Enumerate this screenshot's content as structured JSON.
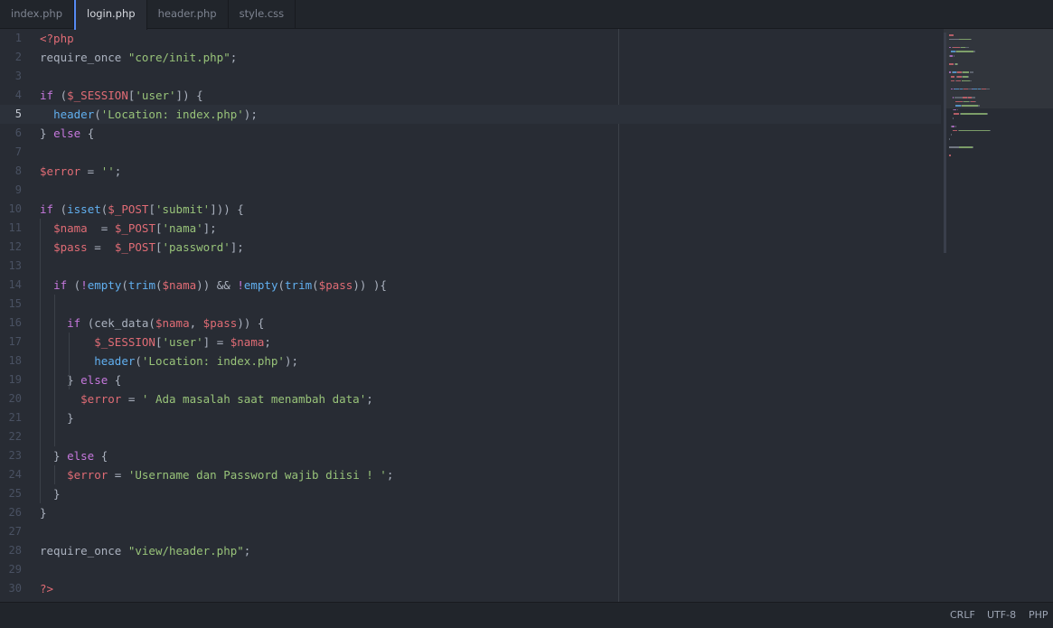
{
  "tabs": [
    {
      "label": "index.php",
      "active": false
    },
    {
      "label": "login.php",
      "active": true
    },
    {
      "label": "header.php",
      "active": false
    },
    {
      "label": "style.css",
      "active": false
    }
  ],
  "editor": {
    "current_line": 5,
    "lines": [
      {
        "n": "1",
        "tokens": [
          [
            "tag",
            "<?php"
          ]
        ]
      },
      {
        "n": "2",
        "tokens": [
          [
            "fnp",
            "require_once "
          ],
          [
            "str",
            "\"core/init.php\""
          ],
          [
            "pun",
            ";"
          ]
        ]
      },
      {
        "n": "3",
        "tokens": []
      },
      {
        "n": "4",
        "tokens": [
          [
            "kw",
            "if"
          ],
          [
            "pun",
            " ("
          ],
          [
            "var",
            "$_SESSION"
          ],
          [
            "pun",
            "["
          ],
          [
            "str",
            "'user'"
          ],
          [
            "pun",
            "]) {"
          ]
        ]
      },
      {
        "n": "5",
        "tokens": [
          [
            "pun",
            "  "
          ],
          [
            "fn",
            "header"
          ],
          [
            "pun",
            "("
          ],
          [
            "str",
            "'Location: index.php'"
          ],
          [
            "pun",
            ");"
          ]
        ]
      },
      {
        "n": "6",
        "tokens": [
          [
            "pun",
            "} "
          ],
          [
            "kw",
            "else"
          ],
          [
            "pun",
            " {"
          ]
        ]
      },
      {
        "n": "7",
        "tokens": []
      },
      {
        "n": "8",
        "tokens": [
          [
            "var",
            "$error"
          ],
          [
            "pun",
            " = "
          ],
          [
            "str",
            "''"
          ],
          [
            "pun",
            ";"
          ]
        ]
      },
      {
        "n": "9",
        "tokens": []
      },
      {
        "n": "10",
        "tokens": [
          [
            "kw",
            "if"
          ],
          [
            "pun",
            " ("
          ],
          [
            "fn",
            "isset"
          ],
          [
            "pun",
            "("
          ],
          [
            "var",
            "$_POST"
          ],
          [
            "pun",
            "["
          ],
          [
            "str",
            "'submit'"
          ],
          [
            "pun",
            "])) {"
          ]
        ]
      },
      {
        "n": "11",
        "tokens": [
          [
            "pun",
            "  "
          ],
          [
            "var",
            "$nama"
          ],
          [
            "pun",
            "  = "
          ],
          [
            "var",
            "$_POST"
          ],
          [
            "pun",
            "["
          ],
          [
            "str",
            "'nama'"
          ],
          [
            "pun",
            "];"
          ]
        ]
      },
      {
        "n": "12",
        "tokens": [
          [
            "pun",
            "  "
          ],
          [
            "var",
            "$pass"
          ],
          [
            "pun",
            " =  "
          ],
          [
            "var",
            "$_POST"
          ],
          [
            "pun",
            "["
          ],
          [
            "str",
            "'password'"
          ],
          [
            "pun",
            "];"
          ]
        ]
      },
      {
        "n": "13",
        "tokens": []
      },
      {
        "n": "14",
        "tokens": [
          [
            "pun",
            "  "
          ],
          [
            "kw",
            "if"
          ],
          [
            "pun",
            " ("
          ],
          [
            "kw",
            "!"
          ],
          [
            "fn",
            "empty"
          ],
          [
            "pun",
            "("
          ],
          [
            "fn",
            "trim"
          ],
          [
            "pun",
            "("
          ],
          [
            "var",
            "$nama"
          ],
          [
            "pun",
            ")) && "
          ],
          [
            "kw",
            "!"
          ],
          [
            "fn",
            "empty"
          ],
          [
            "pun",
            "("
          ],
          [
            "fn",
            "trim"
          ],
          [
            "pun",
            "("
          ],
          [
            "var",
            "$pass"
          ],
          [
            "pun",
            ")) ){"
          ]
        ]
      },
      {
        "n": "15",
        "tokens": []
      },
      {
        "n": "16",
        "tokens": [
          [
            "pun",
            "    "
          ],
          [
            "kw",
            "if"
          ],
          [
            "pun",
            " (cek_data("
          ],
          [
            "var",
            "$nama"
          ],
          [
            "pun",
            ", "
          ],
          [
            "var",
            "$pass"
          ],
          [
            "pun",
            ")) {"
          ]
        ]
      },
      {
        "n": "17",
        "tokens": [
          [
            "pun",
            "        "
          ],
          [
            "var",
            "$_SESSION"
          ],
          [
            "pun",
            "["
          ],
          [
            "str",
            "'user'"
          ],
          [
            "pun",
            "] = "
          ],
          [
            "var",
            "$nama"
          ],
          [
            "pun",
            ";"
          ]
        ]
      },
      {
        "n": "18",
        "tokens": [
          [
            "pun",
            "        "
          ],
          [
            "fn",
            "header"
          ],
          [
            "pun",
            "("
          ],
          [
            "str",
            "'Location: index.php'"
          ],
          [
            "pun",
            ");"
          ]
        ]
      },
      {
        "n": "19",
        "tokens": [
          [
            "pun",
            "    } "
          ],
          [
            "kw",
            "else"
          ],
          [
            "pun",
            " {"
          ]
        ]
      },
      {
        "n": "20",
        "tokens": [
          [
            "pun",
            "      "
          ],
          [
            "var",
            "$error"
          ],
          [
            "pun",
            " = "
          ],
          [
            "str",
            "' Ada masalah saat menambah data'"
          ],
          [
            "pun",
            ";"
          ]
        ]
      },
      {
        "n": "21",
        "tokens": [
          [
            "pun",
            "    }"
          ]
        ]
      },
      {
        "n": "22",
        "tokens": []
      },
      {
        "n": "23",
        "tokens": [
          [
            "pun",
            "  } "
          ],
          [
            "kw",
            "else"
          ],
          [
            "pun",
            " {"
          ]
        ]
      },
      {
        "n": "24",
        "tokens": [
          [
            "pun",
            "    "
          ],
          [
            "var",
            "$error"
          ],
          [
            "pun",
            " = "
          ],
          [
            "str",
            "'Username dan Password wajib diisi ! '"
          ],
          [
            "pun",
            ";"
          ]
        ]
      },
      {
        "n": "25",
        "tokens": [
          [
            "pun",
            "  }"
          ]
        ]
      },
      {
        "n": "26",
        "tokens": [
          [
            "pun",
            "}"
          ]
        ]
      },
      {
        "n": "27",
        "tokens": []
      },
      {
        "n": "28",
        "tokens": [
          [
            "fnp",
            "require_once "
          ],
          [
            "str",
            "\"view/header.php\""
          ],
          [
            "pun",
            ";"
          ]
        ]
      },
      {
        "n": "29",
        "tokens": []
      },
      {
        "n": "30",
        "tokens": [
          [
            "tag",
            "?>"
          ]
        ]
      }
    ]
  },
  "status": {
    "line_ending": "CRLF",
    "encoding": "UTF-8",
    "grammar": "PHP"
  },
  "colors": {
    "background": "#282c34",
    "accent": "#568af2",
    "keyword": "#c678dd",
    "string": "#98c379",
    "variable": "#e06c75",
    "function": "#61afef"
  }
}
